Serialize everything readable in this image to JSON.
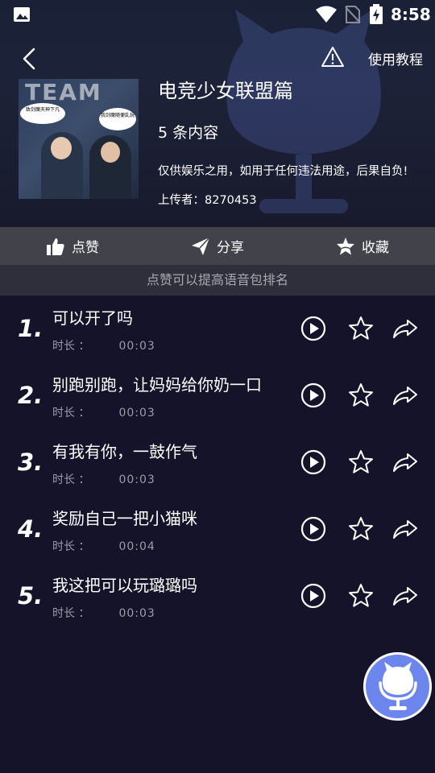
{
  "status_bar": {
    "time": "8:58",
    "icons": [
      "gallery-icon",
      "wifi-icon",
      "no-sim-icon",
      "battery-charging-icon"
    ]
  },
  "header": {
    "back_icon": "chevron-left-icon",
    "warning_icon": "warning-triangle-icon",
    "tutorial_label": "使用教程"
  },
  "pack": {
    "title": "电竞少女联盟篇",
    "count_label": "5 条内容",
    "disclaimer": "仅供娱乐之用，如用于任何违法用途，后果自负!",
    "uploader": "上传者：8270453",
    "cover": {
      "bubble_left": "致剑魔天神下凡",
      "bubble_right": "我剑魔随便乱玩",
      "bg_text": "TEAM"
    }
  },
  "actions": [
    {
      "label": "点赞",
      "icon": "thumbs-up-icon"
    },
    {
      "label": "分享",
      "icon": "paper-plane-icon"
    },
    {
      "label": "收藏",
      "icon": "star-filled-icon"
    }
  ],
  "hint": "点赞可以提高语音包排名",
  "items": [
    {
      "index": "1.",
      "name": "可以开了吗",
      "duration_label": "时长 ：",
      "duration": "00:03"
    },
    {
      "index": "2.",
      "name": "别跑别跑，让妈妈给你奶一口",
      "duration_label": "时长 ：",
      "duration": "00:03"
    },
    {
      "index": "3.",
      "name": "有我有你，一鼓作气",
      "duration_label": "时长 ：",
      "duration": "00:03"
    },
    {
      "index": "4.",
      "name": "奖励自己一把小猫咪",
      "duration_label": "时长 ：",
      "duration": "00:04"
    },
    {
      "index": "5.",
      "name": "我这把可以玩璐璐吗",
      "duration_label": "时长 ：",
      "duration": "00:03"
    }
  ],
  "colors": {
    "background": "#14132a",
    "action_bar": "#42424a",
    "hint_bar": "#2f2f3b",
    "fab": "#6c86ee"
  },
  "fab_icon": "microphone-mascot-icon"
}
